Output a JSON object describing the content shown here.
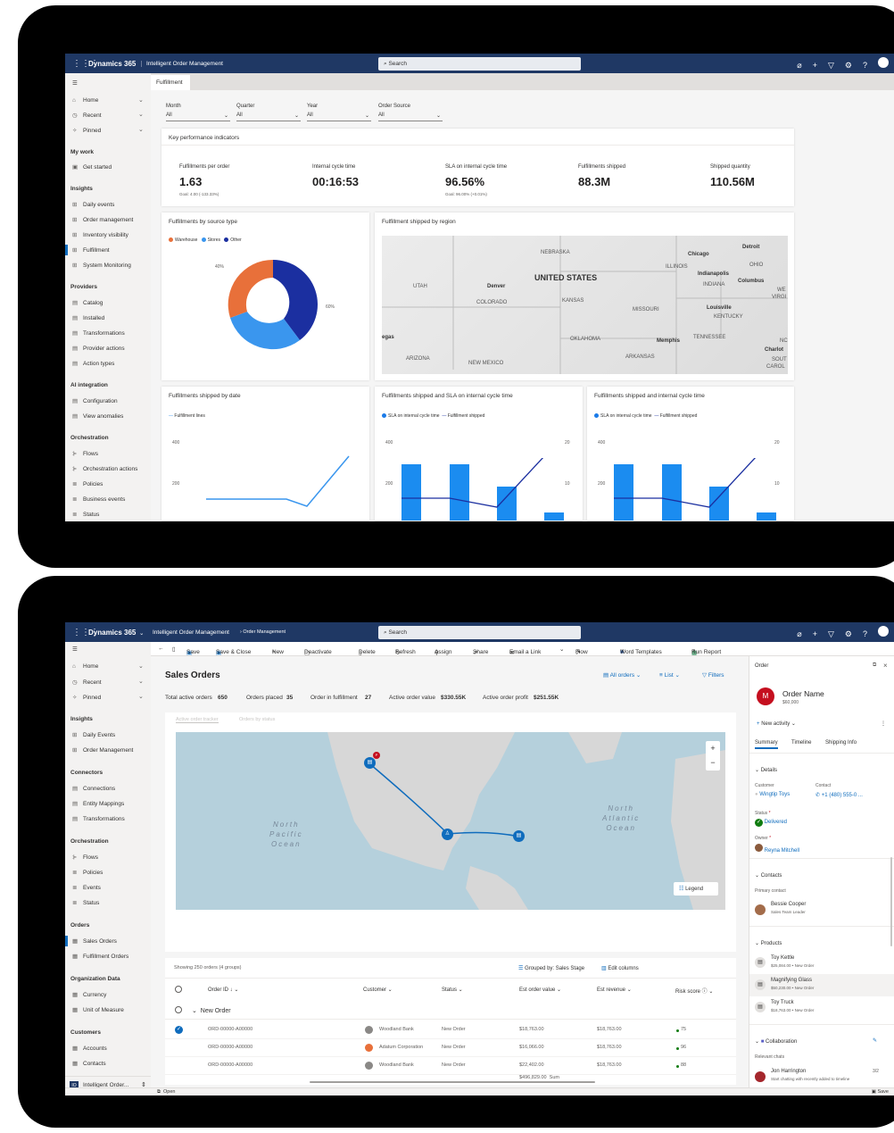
{
  "s1": {
    "brand": "Dynamics 365",
    "app": "Intelligent Order Management",
    "search": "Search",
    "nav": {
      "items1": [
        "Home",
        "Recent",
        "Pinned"
      ],
      "mywork": "My work",
      "getstarted": "Get started",
      "insights": "Insights",
      "insights_items": [
        "Daily events",
        "Order management",
        "Inventory visibility",
        "Fulfillment",
        "System Monitoring"
      ],
      "providers": "Providers",
      "providers_items": [
        "Catalog",
        "Installed",
        "Transformations",
        "Provider actions",
        "Action types"
      ],
      "ai": "AI integration",
      "ai_items": [
        "Configuration",
        "View anomalies"
      ],
      "orch": "Orchestration",
      "orch_items": [
        "Flows",
        "Orchestration actions",
        "Policies",
        "Business events",
        "Status"
      ]
    },
    "tab": "Fulfillment",
    "filters": [
      {
        "label": "Month",
        "value": "All"
      },
      {
        "label": "Quarter",
        "value": "All"
      },
      {
        "label": "Year",
        "value": "All"
      },
      {
        "label": "Order Source",
        "value": "All"
      }
    ],
    "kpi": {
      "title": "Key performance indicators",
      "items": [
        {
          "label": "Fulfillments per order",
          "value": "1.63",
          "goal": "Goal: 4.00 (-133.33%)"
        },
        {
          "label": "Internal cycle time",
          "value": "00:16:53",
          "goal": ""
        },
        {
          "label": "SLA on internal cycle time",
          "value": "96.56%",
          "goal": "Goal: 96.00% (+0.01%)"
        },
        {
          "label": "Fulfillments shipped",
          "value": "88.3M",
          "goal": ""
        },
        {
          "label": "Shipped quantity",
          "value": "110.56M",
          "goal": ""
        }
      ]
    },
    "donut": {
      "title": "Fulfillments by source type",
      "legend": [
        "Warehouse",
        "Stores",
        "Other"
      ],
      "colors": [
        "#e8703a",
        "#3a96ee",
        "#1b2fa0"
      ],
      "label40": "40%",
      "label60": "60%"
    },
    "mapcard": {
      "title": "Fulfillment shipped by region",
      "labels": [
        "NEBRASKA",
        "UNITED STATES",
        "Denver",
        "UTAH",
        "COLORADO",
        "KANSAS",
        "MISSOURI",
        "ILLINOIS",
        "Chicago",
        "Detroit",
        "OHIO",
        "Indianapolis",
        "INDIANA",
        "Columbus",
        "Louisville",
        "KENTUCKY",
        "OKLAHOMA",
        "Memphis",
        "TENNESSEE",
        "ARKANSAS",
        "ARIZONA",
        "NEW MEXICO",
        "egas",
        "Charlot",
        "SOUT",
        "CAROL",
        "WE",
        "VIRGI",
        "NC"
      ]
    },
    "c1": {
      "title": "Fulfillments shipped by date",
      "legend": "Fulfillment lines",
      "t400": "400",
      "t200": "200"
    },
    "c2": {
      "title": "Fulfillments shipped and SLA on internal cycle time",
      "legend1": "SLA on internal cycle time",
      "legend2": "Fulfillment shipped",
      "t400": "400",
      "t200": "200",
      "t20": "20",
      "t10": "10"
    },
    "c3": {
      "title": "Fulfillments shipped and internal cycle time",
      "legend1": "SLA on internal cycle time",
      "legend2": "Fulfillment shipped",
      "t400": "400",
      "t200": "200",
      "t20": "20",
      "t10": "10"
    }
  },
  "s2": {
    "brand": "Dynamics 365",
    "app": "Intelligent Order Management",
    "crumb": "Order Management",
    "search": "Search",
    "cmd": [
      "Save",
      "Save & Close",
      "New",
      "Deactivate",
      "Delete",
      "Refresh",
      "Assign",
      "Share",
      "Email a Link",
      "Flow",
      "Word Templates",
      "Run Report"
    ],
    "nav": {
      "items1": [
        "Home",
        "Recent",
        "Pinned"
      ],
      "insights": "Insights",
      "insights_items": [
        "Daily Events",
        "Order Management"
      ],
      "connectors": "Connectors",
      "connectors_items": [
        "Connections",
        "Entity Mappings",
        "Transformations"
      ],
      "orch": "Orchestration",
      "orch_items": [
        "Flows",
        "Policies",
        "Events",
        "Status"
      ],
      "orders": "Orders",
      "orders_items": [
        "Sales Orders",
        "Fulfillment Orders"
      ],
      "orgdata": "Organization Data",
      "orgdata_items": [
        "Currency",
        "Unit of Measure"
      ],
      "customers": "Customers",
      "customers_items": [
        "Accounts",
        "Contacts"
      ],
      "area": "Intelligent Order..."
    },
    "title": "Sales Orders",
    "views": [
      "All orders",
      "List",
      "Filters"
    ],
    "kpis": [
      "Total active orders",
      "650",
      "Orders placed",
      "35",
      "Order in fulfillment",
      "27",
      "Active order value",
      "$330.55K",
      "Active order profit",
      "$251.55K"
    ],
    "maptabs": [
      "Active order tracker",
      "Orders by status"
    ],
    "map": {
      "pacific": [
        "North",
        "Pacific",
        "Ocean"
      ],
      "atlantic": [
        "North",
        "Atlantic",
        "Ocean"
      ],
      "legend": "Legend",
      "zoomin": "+",
      "zoomout": "−"
    },
    "grid": {
      "showing": "Showing 250 orders (4 groups)",
      "grouped": "Grouped by: Sales Stage",
      "edit": "Edit columns",
      "cols": [
        "Order ID",
        "Customer",
        "Status",
        "Est order value",
        "Est revenue",
        "Risk score"
      ],
      "group": "New Order",
      "rows": [
        {
          "id": "ORD-00000-A00000",
          "customer": "Woodland Bank",
          "status": "New Order",
          "value": "$18,763.00",
          "revenue": "$18,763.00",
          "risk": "75",
          "ic": "#8a8886"
        },
        {
          "id": "ORD-00000-A00000",
          "customer": "Adatum Corporation",
          "status": "New Order",
          "value": "$16,066.00",
          "revenue": "$18,763.00",
          "risk": "96",
          "ic": "#e8703a"
        },
        {
          "id": "ORD-00000-A00000",
          "customer": "Woodland Bank",
          "status": "New Order",
          "value": "$22,402.00",
          "revenue": "$18,763.00",
          "risk": "88",
          "ic": "#8a8886"
        }
      ],
      "sum": "$496,829.00",
      "sumlabel": "Sum"
    },
    "panel": {
      "header": "Order",
      "name": "Order Name",
      "amount": "$60,000",
      "newact": "New activity",
      "tabs": [
        "Summary",
        "Timeline",
        "Shipping Info"
      ],
      "details": "Details",
      "customer_l": "Customer",
      "customer": "Wingtip Toys",
      "contact_l": "Contact",
      "contact": "+1 (480) 555-0 ...",
      "status_l": "Status",
      "status": "Delivered",
      "owner_l": "Owner",
      "owner": "Reyna Mitchell",
      "contacts": "Contacts",
      "primary": "Primary contact",
      "pc_name": "Bessie Cooper",
      "pc_title": "Sales Team Leader",
      "products": "Products",
      "prods": [
        {
          "n": "Toy Kettle",
          "d": "$25,084.00 • New Order"
        },
        {
          "n": "Magnifying Glass",
          "d": "$50,230.00 • New Order"
        },
        {
          "n": "Toy Truck",
          "d": "$18,763.00 • New Order"
        }
      ],
      "collab": "Collaboration",
      "relevant": "Relevant chats",
      "chat": "Jon Harrington",
      "chatnote": "Start chatting with recently added to timeline",
      "chatcount": "3/2"
    },
    "statusbar": {
      "open": "Open",
      "save": "Save"
    }
  }
}
